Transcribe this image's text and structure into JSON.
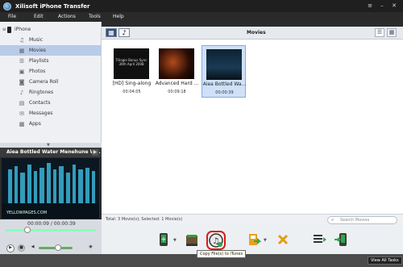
{
  "app": {
    "title": "Xilisoft iPhone Transfer"
  },
  "menu": [
    "File",
    "Edit",
    "Actions",
    "Tools",
    "Help"
  ],
  "sidebar": {
    "device": "iPhone",
    "items": [
      {
        "label": "Music",
        "icon": "music-note-icon"
      },
      {
        "label": "Movies",
        "icon": "film-icon",
        "selected": true
      },
      {
        "label": "Playlists",
        "icon": "playlist-icon"
      },
      {
        "label": "Photos",
        "icon": "photo-icon"
      },
      {
        "label": "Camera Roll",
        "icon": "camera-icon"
      },
      {
        "label": "Ringtones",
        "icon": "bell-icon"
      },
      {
        "label": "Contacts",
        "icon": "contacts-icon"
      },
      {
        "label": "Messages",
        "icon": "message-icon"
      },
      {
        "label": "Apps",
        "icon": "apps-icon"
      }
    ]
  },
  "now_playing": {
    "title": "Aiea Bottled Water Menehune W...",
    "watermark": "YELLOWPAGES.COM"
  },
  "player": {
    "time": "00:00:09 / 00:00:39",
    "progress": 0.23
  },
  "content": {
    "header_title": "Movies",
    "tiles": [
      {
        "name": "[HD] Sing-along",
        "duration": "00:04:05",
        "thumb_text": "Trilogie Bonus Sync 30th April 2008"
      },
      {
        "name": "Advanced Hard ...",
        "duration": "00:09:18",
        "thumb_text": ""
      },
      {
        "name": "Aiea Bottled Wa...",
        "duration": "00:00:39",
        "thumb_text": "",
        "selected": true
      }
    ]
  },
  "status": {
    "text": "Total: 3 Movie(s); Selected: 1 Movie(s)",
    "search_placeholder": "Search Movies"
  },
  "tooltip": "Copy File(s) to iTunes",
  "tasks_button": "View All Tasks",
  "colors": {
    "selection": "#b9cbe9",
    "header_active": "#314e80",
    "highlight_ring": "#d81b1b"
  }
}
